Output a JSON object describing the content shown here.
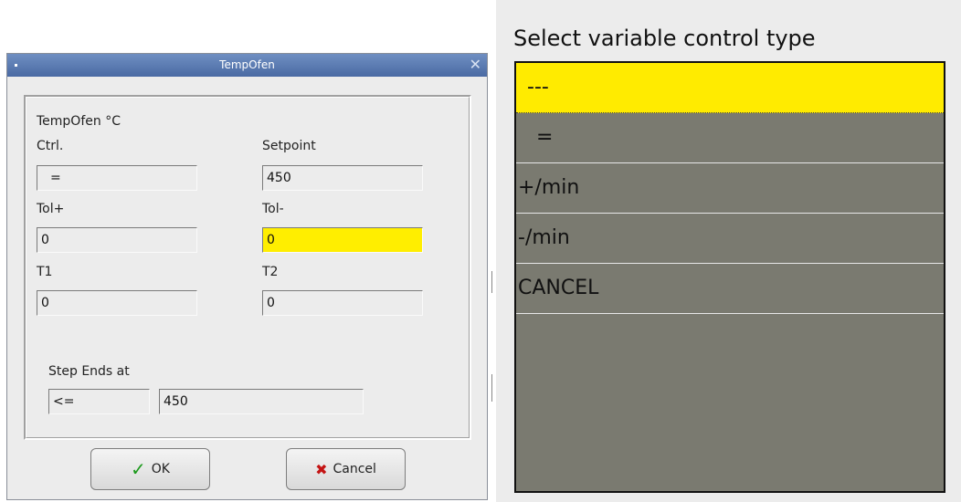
{
  "dialog": {
    "title": "TempOfen",
    "close_glyph": "✕",
    "heading": "TempOfen °C",
    "ctrl_label": "Ctrl.",
    "ctrl_value": "=",
    "setpoint_label": "Setpoint",
    "setpoint_value": "450",
    "tolplus_label": "Tol+",
    "tolplus_value": "0",
    "tolminus_label": "Tol-",
    "tolminus_value": "0",
    "t1_label": "T1",
    "t1_value": "0",
    "t2_label": "T2",
    "t2_value": "0",
    "step_ends_label": "Step Ends at",
    "step_op_value": "<=",
    "step_value": "450",
    "ok_label": "OK",
    "cancel_label": "Cancel",
    "highlight_color": "#ffee00"
  },
  "selector": {
    "title": "Select variable control type",
    "options": [
      "---",
      "=",
      "+/min",
      "-/min",
      "CANCEL"
    ],
    "selected_index": 0,
    "selected_color": "#ffeb00",
    "list_bg_color": "#7a7a70"
  }
}
